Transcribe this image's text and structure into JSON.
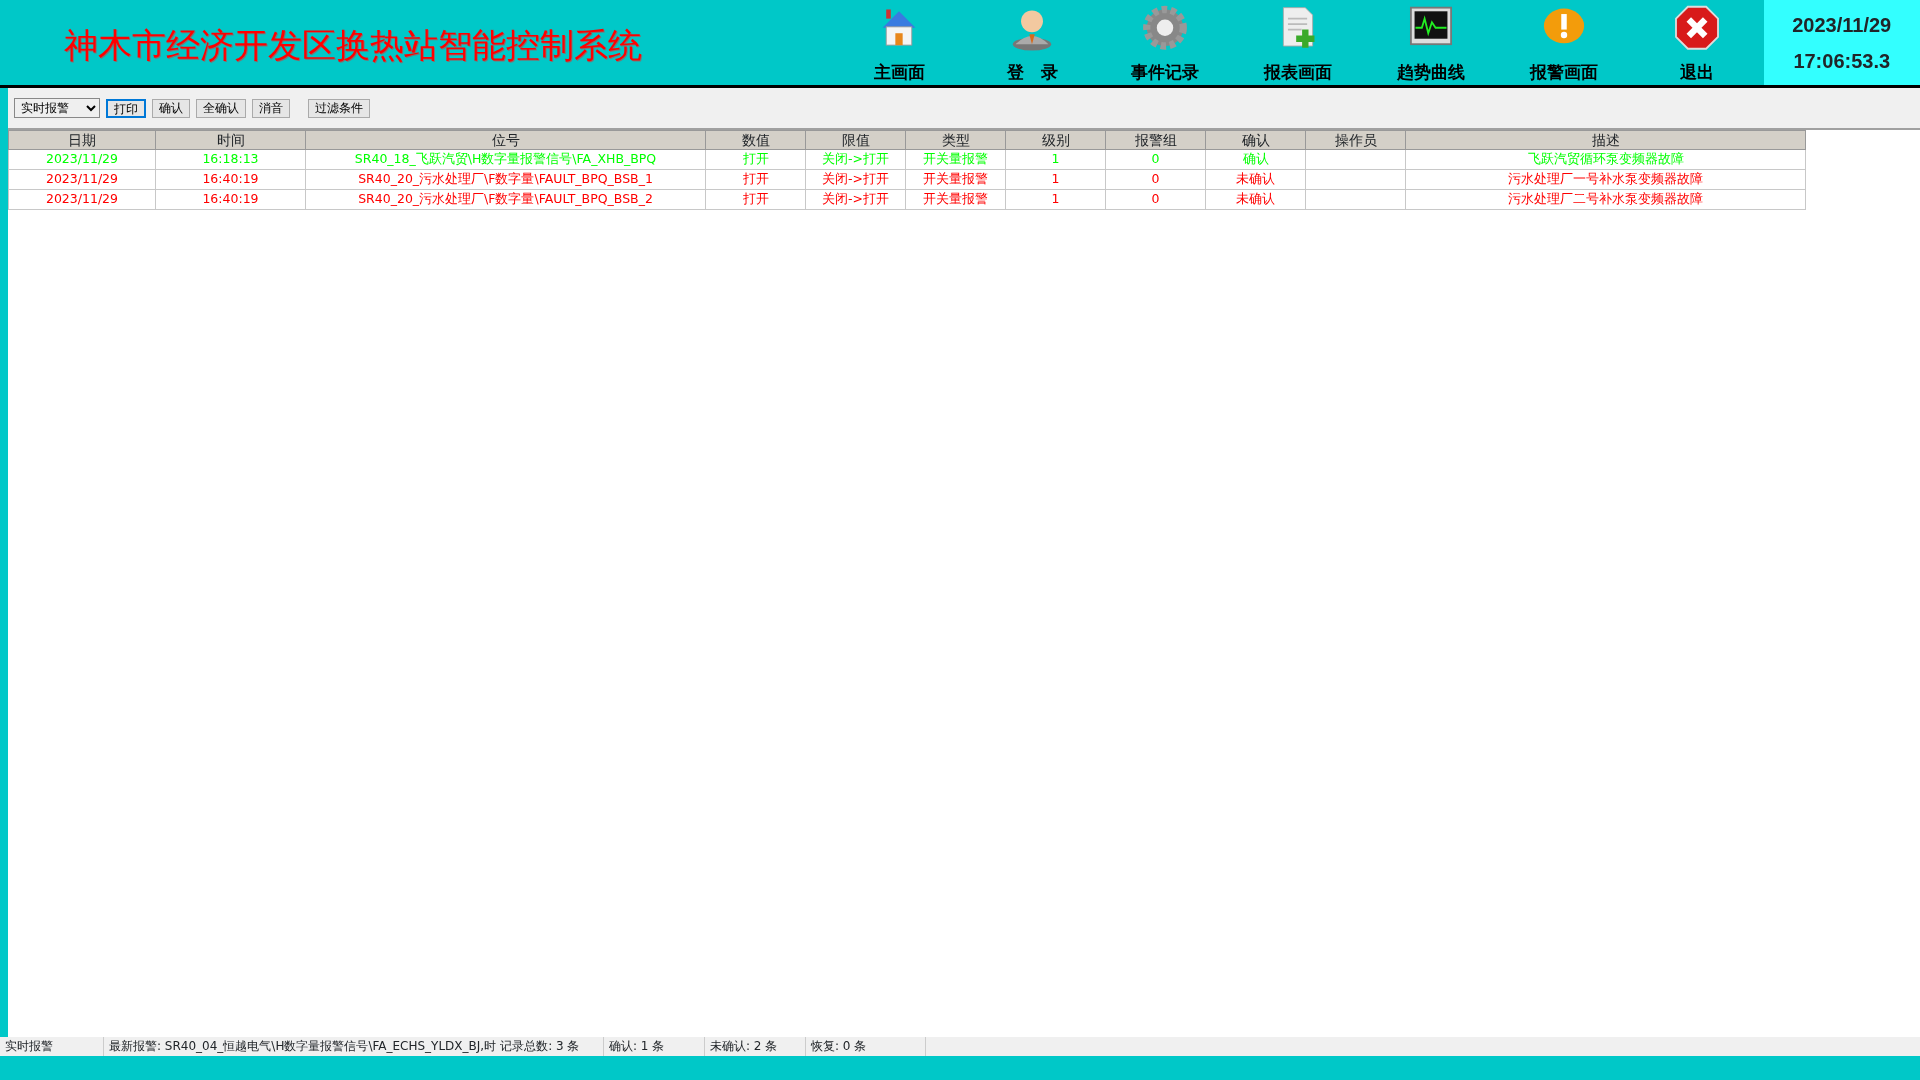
{
  "header": {
    "title": "神木市经济开发区换热站智能控制系统",
    "nav": [
      {
        "kind": "home",
        "label": "主画面"
      },
      {
        "kind": "user",
        "label": "登　录"
      },
      {
        "kind": "gear",
        "label": "事件记录"
      },
      {
        "kind": "report",
        "label": "报表画面"
      },
      {
        "kind": "trend",
        "label": "趋势曲线"
      },
      {
        "kind": "alarm",
        "label": "报警画面"
      },
      {
        "kind": "exit",
        "label": "退出"
      }
    ],
    "date": "2023/11/29",
    "time": "17:06:53.3"
  },
  "toolbar": {
    "mode": "实时报警",
    "buttons": [
      {
        "label": "打印",
        "focused": true
      },
      {
        "label": "确认",
        "focused": false
      },
      {
        "label": "全确认",
        "focused": false
      },
      {
        "label": "消音",
        "focused": false
      },
      {
        "label": "过滤条件",
        "focused": false
      }
    ]
  },
  "table": {
    "columns": [
      "日期",
      "时间",
      "位号",
      "数值",
      "限值",
      "类型",
      "级别",
      "报警组",
      "确认",
      "操作员",
      "描述"
    ],
    "rows": [
      {
        "color": "#00ff00",
        "cells": [
          "2023/11/29",
          "16:18:13",
          "SR40_18_飞跃汽贸\\H数字量报警信号\\FA_XHB_BPQ",
          "打开",
          "关闭->打开",
          "开关量报警",
          "1",
          "0",
          "确认",
          "",
          "飞跃汽贸循环泵变频器故障"
        ]
      },
      {
        "color": "#ff0000",
        "cells": [
          "2023/11/29",
          "16:40:19",
          "SR40_20_污水处理厂\\F数字量\\FAULT_BPQ_BSB_1",
          "打开",
          "关闭->打开",
          "开关量报警",
          "1",
          "0",
          "未确认",
          "",
          "污水处理厂一号补水泵变频器故障"
        ]
      },
      {
        "color": "#ff0000",
        "cells": [
          "2023/11/29",
          "16:40:19",
          "SR40_20_污水处理厂\\F数字量\\FAULT_BPQ_BSB_2",
          "打开",
          "关闭->打开",
          "开关量报警",
          "1",
          "0",
          "未确认",
          "",
          "污水处理厂二号补水泵变频器故障"
        ]
      }
    ]
  },
  "status_bar": {
    "mode": "实时报警",
    "latest": "最新报警: SR40_04_恒越电气\\H数字量报警信号\\FA_ECHS_YLDX_BJ,时",
    "total": "记录总数: 3 条",
    "confirmed": "确认: 1 条",
    "unconfirmed": "未确认: 2 条",
    "recovered": "恢复: 0 条"
  }
}
